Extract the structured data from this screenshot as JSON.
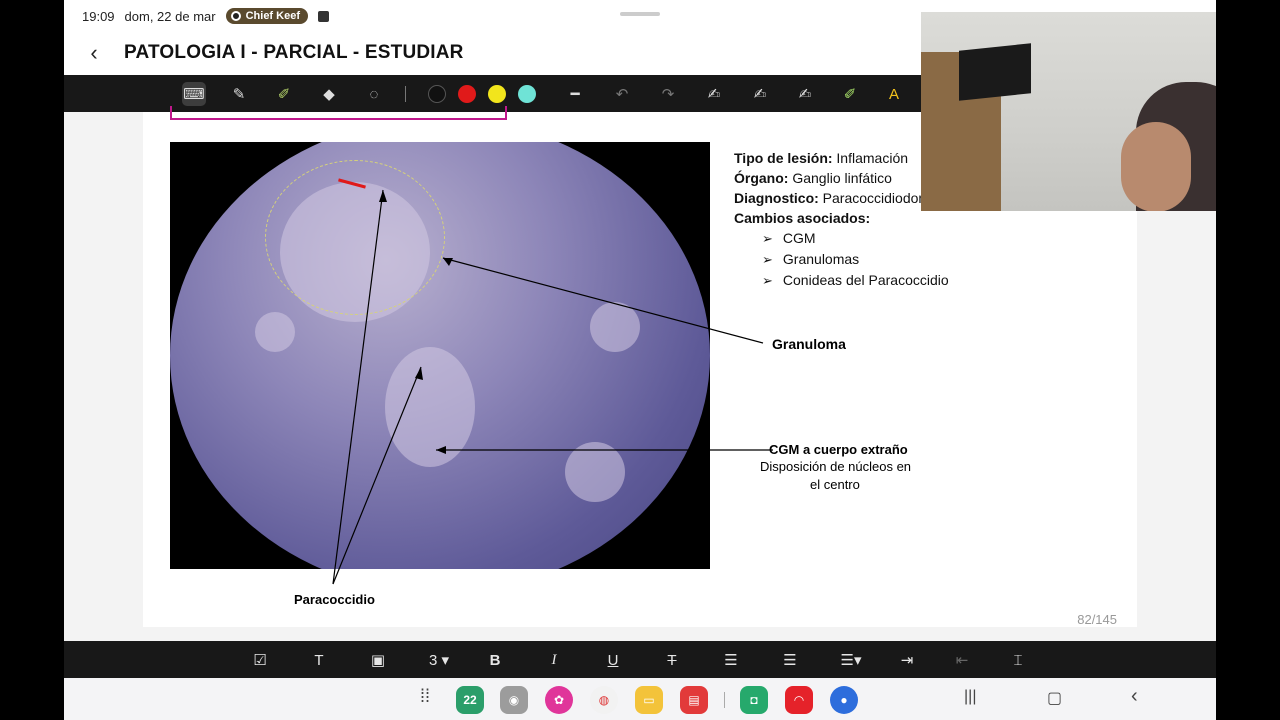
{
  "status": {
    "time": "19:09",
    "date": "dom, 22 de mar",
    "media": "Chief Keef"
  },
  "title": "PATOLOGIA I - PARCIAL - ESTUDIAR",
  "toolbar": {
    "colors": [
      "#111111",
      "#e01a1a",
      "#f2e51c",
      "#6fe3d6"
    ]
  },
  "slide": {
    "info": {
      "tipo_label": "Tipo de lesión:",
      "tipo_value": "Inflamación",
      "organo_label": "Órgano:",
      "organo_value": "Ganglio linfático",
      "diag_label": "Diagnostico:",
      "diag_value": "Paracoccidiodomicosis",
      "cambios_label": "Cambios asociados:",
      "bullets": [
        "CGM",
        "Granulomas",
        "Conideas del Paracoccidio"
      ]
    },
    "labels": {
      "granuloma": "Granuloma",
      "cgm_title": "CGM a cuerpo extraño",
      "cgm_desc1": "Disposición de núcleos en",
      "cgm_desc2": "el centro",
      "paracoccidio": "Paracoccidio"
    },
    "page_num": "82/145"
  },
  "format": {
    "size": "3"
  },
  "nav": {
    "calendar_day": "22"
  }
}
